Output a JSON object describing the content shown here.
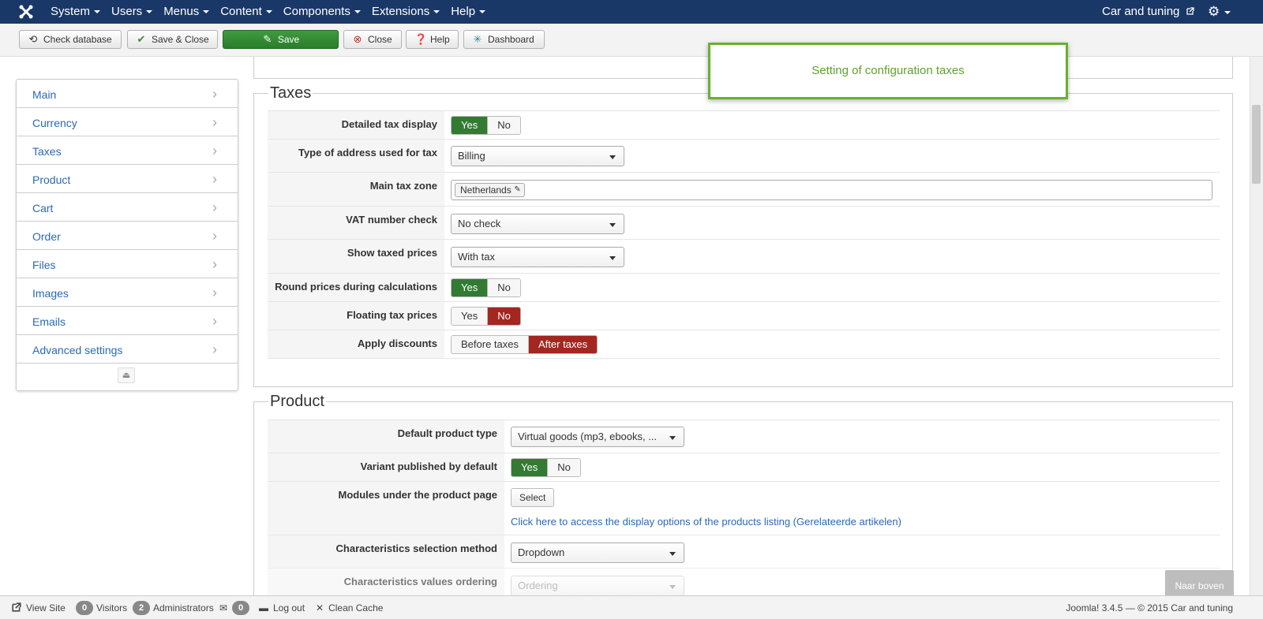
{
  "navbar": {
    "menu": [
      "System",
      "Users",
      "Menus",
      "Content",
      "Components",
      "Extensions",
      "Help"
    ],
    "site_name": "Car and tuning"
  },
  "toolbar": {
    "check_database": "Check database",
    "save_close": "Save & Close",
    "save": "Save",
    "close": "Close",
    "help": "Help",
    "dashboard": "Dashboard"
  },
  "notification": "Setting of configuration taxes",
  "sidebar": {
    "items": [
      "Main",
      "Currency",
      "Taxes",
      "Product",
      "Cart",
      "Order",
      "Files",
      "Images",
      "Emails",
      "Advanced settings"
    ]
  },
  "taxes": {
    "legend": "Taxes",
    "detailed_tax_display": {
      "label": "Detailed tax display",
      "yes": "Yes",
      "no": "No",
      "value": "Yes"
    },
    "address_type": {
      "label": "Type of address used for tax",
      "value": "Billing"
    },
    "main_tax_zone": {
      "label": "Main tax zone",
      "tag": "Netherlands"
    },
    "vat_check": {
      "label": "VAT number check",
      "value": "No check"
    },
    "show_taxed_prices": {
      "label": "Show taxed prices",
      "value": "With tax"
    },
    "round_prices": {
      "label": "Round prices during calculations",
      "yes": "Yes",
      "no": "No",
      "value": "Yes"
    },
    "floating_tax": {
      "label": "Floating tax prices",
      "yes": "Yes",
      "no": "No",
      "value": "No"
    },
    "apply_discounts": {
      "label": "Apply discounts",
      "before": "Before taxes",
      "after": "After taxes",
      "value": "After taxes"
    }
  },
  "product": {
    "legend": "Product",
    "default_type": {
      "label": "Default product type",
      "value": "Virtual goods (mp3, ebooks, ..."
    },
    "variant_published": {
      "label": "Variant published by default",
      "yes": "Yes",
      "no": "No",
      "value": "Yes"
    },
    "modules": {
      "label": "Modules under the product page",
      "button": "Select",
      "link": "Click here to access the display options of the products listing (Gerelateerde artikelen)"
    },
    "char_method": {
      "label": "Characteristics selection method",
      "value": "Dropdown"
    },
    "char_ordering": {
      "label": "Characteristics values ordering",
      "value": "Ordering"
    }
  },
  "back_to_top": "Naar boven",
  "statusbar": {
    "view_site": "View Site",
    "visitors_count": "0",
    "visitors": "Visitors",
    "admins_count": "2",
    "administrators": "Administrators",
    "messages_count": "0",
    "logout": "Log out",
    "clean_cache": "Clean Cache",
    "footer": "Joomla! 3.4.5  —  © 2015 Car and tuning"
  },
  "colors": {
    "navbar": "#1a3867",
    "yes_active": "#337a33",
    "no_active": "#a4261f",
    "save": "#2a7d2a",
    "link": "#2a69b8",
    "notify": "#6ab02f"
  }
}
